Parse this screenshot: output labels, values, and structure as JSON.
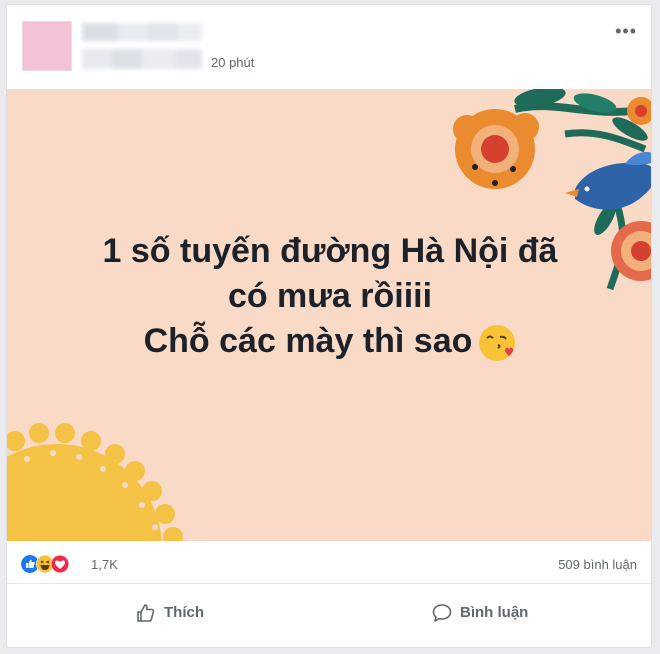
{
  "post": {
    "timestamp": "20 phút",
    "more_label": "•••",
    "text_lines": [
      "1 số tuyến đường Hà Nội đã",
      "có mưa rồiiii",
      "Chỗ các mày thì sao"
    ],
    "emoji": "face-blowing-kiss",
    "background_color": "#f9dac6"
  },
  "stats": {
    "reactions": [
      "like",
      "haha",
      "love"
    ],
    "reaction_count": "1,7K",
    "comment_count": "509 bình luận"
  },
  "actions": {
    "like_label": "Thích",
    "comment_label": "Bình luận"
  }
}
